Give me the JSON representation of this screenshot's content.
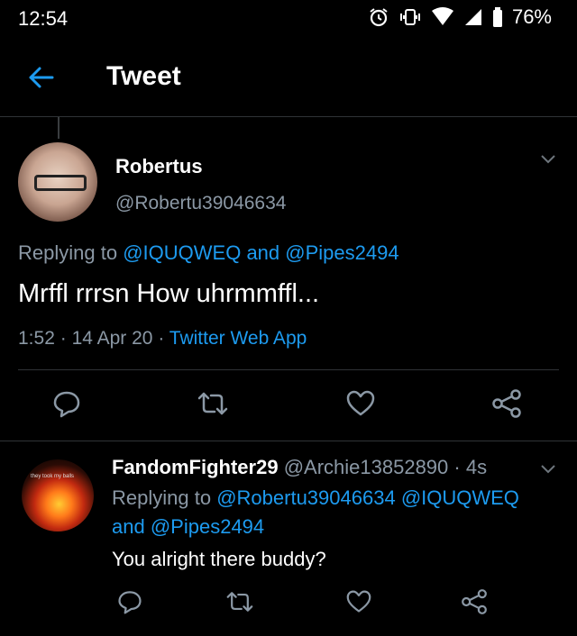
{
  "status_bar": {
    "time": "12:54",
    "battery": "76%",
    "icons": [
      "alarm-icon",
      "vibrate-icon",
      "wifi-icon",
      "signal-icon",
      "battery-icon"
    ]
  },
  "header": {
    "title": "Tweet",
    "back_icon": "arrow-left-icon",
    "accent_color": "#1d9bf0"
  },
  "main_tweet": {
    "display_name": "Robertus",
    "handle": "@Robertu39046634",
    "replying_prefix": "Replying to",
    "replying_user1": "@IQUQWEQ",
    "replying_and": "and",
    "replying_user2": "@Pipes2494",
    "text": "Mrffl rrrsn How uhrmmffl...",
    "time": "1:52",
    "date": "14 Apr 20",
    "sep": "·",
    "source": "Twitter Web App"
  },
  "reply_tweet": {
    "display_name": "FandomFighter29",
    "handle": "@Archie13852890",
    "sep": "·",
    "time_ago": "4s",
    "replying_prefix": "Replying to",
    "replying_user1": "@Robertu39046634",
    "replying_user2": "@IQUQWEQ",
    "replying_and": "and",
    "replying_user3": "@Pipes2494",
    "text": "You alright there buddy?",
    "avatar_caption": "they took my balls"
  },
  "actions": [
    "reply-icon",
    "retweet-icon",
    "like-icon",
    "share-icon"
  ],
  "colors": {
    "background": "#000000",
    "text": "#e7e9ea",
    "secondary": "#8b98a5",
    "link": "#1d9bf0",
    "divider": "#2f3336"
  }
}
